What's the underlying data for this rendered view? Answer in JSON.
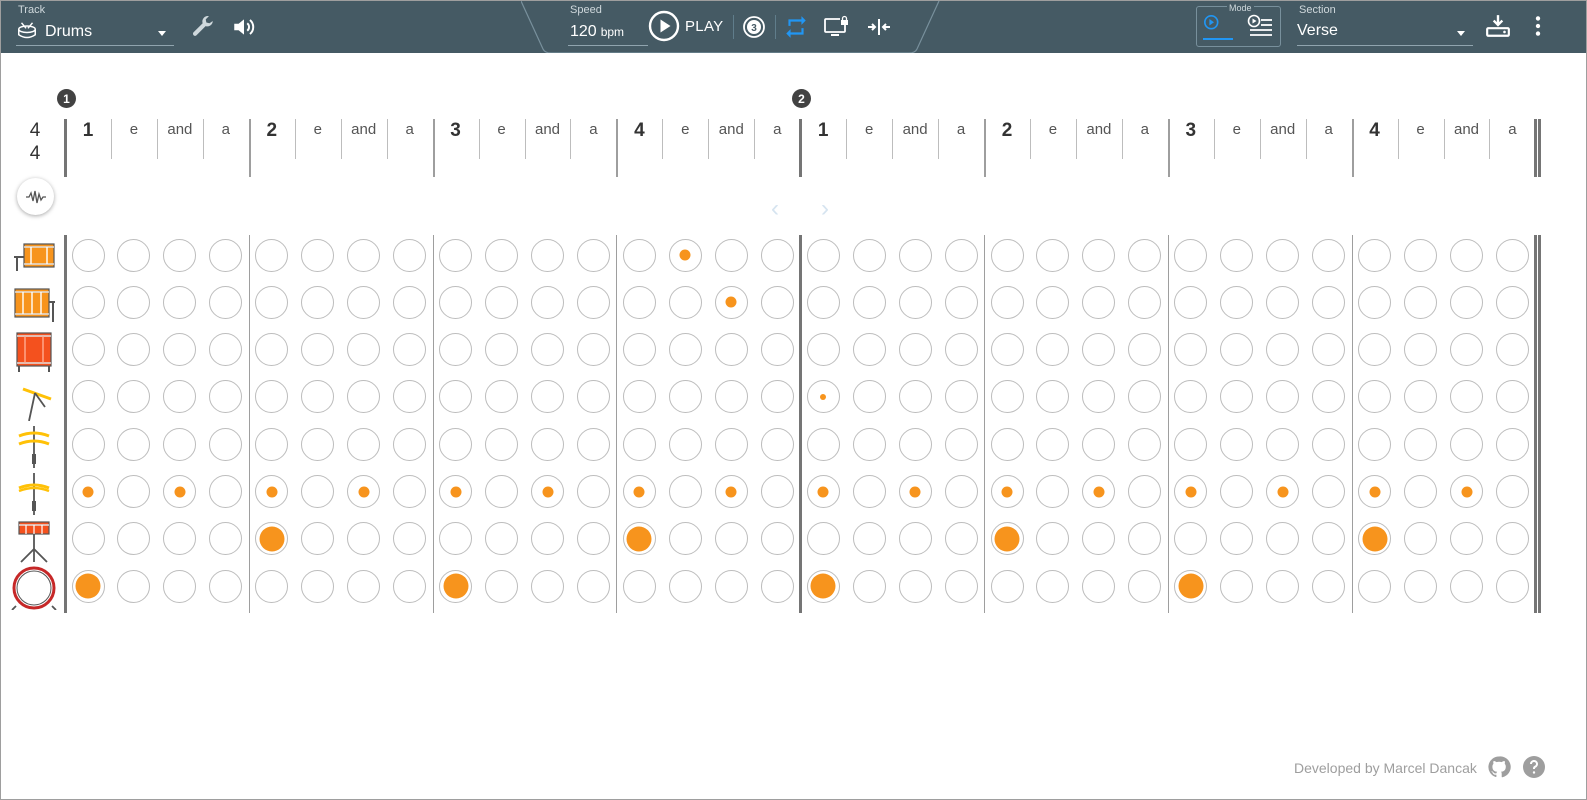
{
  "toolbar": {
    "track_label": "Track",
    "track_value": "Drums",
    "speed_label": "Speed",
    "speed_value": "120",
    "speed_unit": "bpm",
    "play_label": "PLAY",
    "countdown_value": "3",
    "mode_label": "Mode",
    "section_label": "Section",
    "section_value": "Verse",
    "accent_color": "#2196f3",
    "bar_color": "#455a64"
  },
  "icons": [
    "snare-drum-icon",
    "wrench-icon",
    "volume-icon",
    "play-circle-icon",
    "countdown-3-icon",
    "loop-icon",
    "screen-lock-icon",
    "collapse-icon",
    "mode-play-icon",
    "mode-list-icon",
    "download-icon",
    "more-vert-icon",
    "waveform-icon",
    "github-icon",
    "help-icon"
  ],
  "grid": {
    "measures": [
      "1",
      "2"
    ],
    "time_signature": {
      "top": "4",
      "bottom": "4"
    },
    "beat_labels": [
      "1",
      "e",
      "and",
      "a",
      "2",
      "e",
      "and",
      "a",
      "3",
      "e",
      "and",
      "a",
      "4",
      "e",
      "and",
      "a",
      "1",
      "e",
      "and",
      "a",
      "2",
      "e",
      "and",
      "a",
      "3",
      "e",
      "and",
      "a",
      "4",
      "e",
      "and",
      "a"
    ],
    "note_color": "#f7941d",
    "instruments": [
      {
        "name": "high-tom",
        "hits": [
          [
            13,
            "m"
          ]
        ]
      },
      {
        "name": "mid-tom",
        "hits": [
          [
            14,
            "m"
          ]
        ]
      },
      {
        "name": "floor-tom",
        "hits": []
      },
      {
        "name": "crash-cymbal",
        "hits": [
          [
            16,
            "s"
          ]
        ]
      },
      {
        "name": "open-hi-hat",
        "hits": []
      },
      {
        "name": "closed-hi-hat",
        "hits": [
          [
            0,
            "m"
          ],
          [
            2,
            "m"
          ],
          [
            4,
            "m"
          ],
          [
            6,
            "m"
          ],
          [
            8,
            "m"
          ],
          [
            10,
            "m"
          ],
          [
            12,
            "m"
          ],
          [
            14,
            "m"
          ],
          [
            16,
            "m"
          ],
          [
            18,
            "m"
          ],
          [
            20,
            "m"
          ],
          [
            22,
            "m"
          ],
          [
            24,
            "m"
          ],
          [
            26,
            "m"
          ],
          [
            28,
            "m"
          ],
          [
            30,
            "m"
          ]
        ]
      },
      {
        "name": "snare-drum",
        "hits": [
          [
            4,
            "l"
          ],
          [
            12,
            "l"
          ],
          [
            20,
            "l"
          ],
          [
            28,
            "l"
          ]
        ]
      },
      {
        "name": "bass-drum",
        "hits": [
          [
            0,
            "l"
          ],
          [
            8,
            "l"
          ],
          [
            16,
            "l"
          ],
          [
            24,
            "l"
          ]
        ]
      }
    ]
  },
  "footer": {
    "credit": "Developed by Marcel Dancak"
  }
}
